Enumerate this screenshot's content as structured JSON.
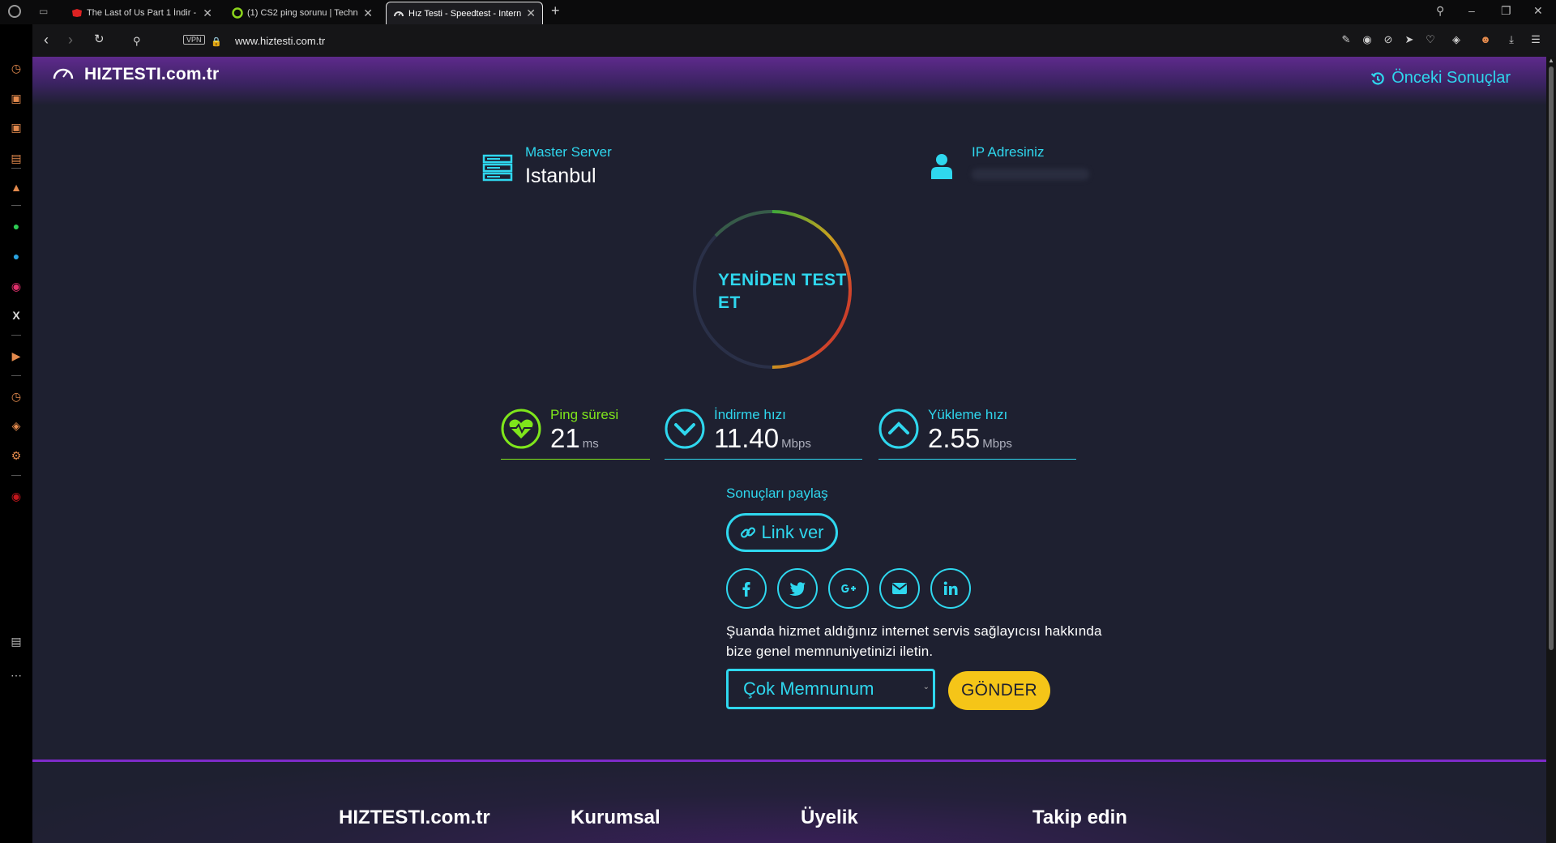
{
  "browser": {
    "tabs": [
      {
        "title": "The Last of Us Part 1 İndir -",
        "active": false
      },
      {
        "title": "(1) CS2 ping sorunu | Techn",
        "active": false
      },
      {
        "title": "Hız Testi - Speedtest - Intern",
        "active": true
      }
    ],
    "url": "www.hiztesti.com.tr",
    "vpn_label": "VPN",
    "new_tab_symbol": "+",
    "close_symbol": "✕"
  },
  "sidebar": {
    "icons": [
      "speed-dial-icon",
      "shopping-icon",
      "twitch-icon",
      "news-icon",
      "aria-icon",
      "whatsapp-icon",
      "telegram-icon",
      "instagram-icon",
      "x-icon",
      "player-icon",
      "history-icon",
      "extensions-icon",
      "settings-icon",
      "ublock-icon",
      "pinboard-icon",
      "more-icon"
    ]
  },
  "header": {
    "logo": "HIZTESTI.com.tr",
    "prev_results": "Önceki Sonuçlar"
  },
  "server": {
    "label": "Master Server",
    "value": "Istanbul"
  },
  "ip": {
    "label": "IP Adresiniz"
  },
  "gauge": {
    "retest_line1": "YENİDEN TEST",
    "retest_line2": "ET"
  },
  "stats": {
    "ping": {
      "label": "Ping süresi",
      "value": "21",
      "unit": "ms",
      "color": "#7fe61b"
    },
    "download": {
      "label": "İndirme hızı",
      "value": "11.40",
      "unit": "Mbps",
      "color": "#2fd7ee"
    },
    "upload": {
      "label": "Yükleme hızı",
      "value": "2.55",
      "unit": "Mbps",
      "color": "#2fd7ee"
    }
  },
  "share": {
    "title": "Sonuçları paylaş",
    "link_button": "Link ver",
    "networks": [
      "facebook-icon",
      "twitter-icon",
      "google-plus-icon",
      "email-icon",
      "linkedin-icon"
    ]
  },
  "feedback": {
    "text": "Şuanda hizmet aldığınız internet servis sağlayıcısı hakkında bize genel memnuniyetinizi iletin.",
    "selected": "Çok Memnunum",
    "send": "GÖNDER"
  },
  "footer": {
    "col1": "HIZTESTI.com.tr",
    "col2": "Kurumsal",
    "col3": "Üyelik",
    "col4": "Takip edin"
  },
  "colors": {
    "accent": "#2fd7ee",
    "ping_green": "#7fe61b",
    "send_yellow": "#f5c518",
    "header_purple": "#5e2a8c",
    "page_bg": "#1e2030"
  }
}
